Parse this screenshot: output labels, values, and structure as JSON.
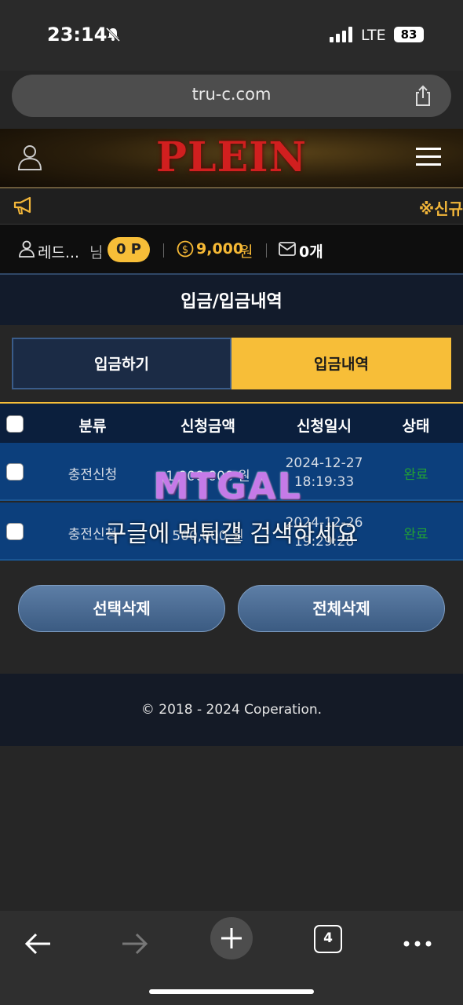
{
  "status_bar": {
    "time": "23:14",
    "network": "LTE",
    "battery": "83"
  },
  "browser": {
    "url": "tru-c.com",
    "tabs_count": "4"
  },
  "header": {
    "logo": "PLEIN"
  },
  "notice": {
    "text": "※신규"
  },
  "user": {
    "name": "레드...",
    "suffix": "님",
    "points": "0 P",
    "money": "9,000",
    "money_unit": "원",
    "messages": "0개"
  },
  "page": {
    "title": "입금/입금내역"
  },
  "tabs": [
    {
      "label": "입금하기"
    },
    {
      "label": "입금내역",
      "active": true
    }
  ],
  "table": {
    "columns": [
      "분류",
      "신청금액",
      "신청일시",
      "상태"
    ],
    "rows": [
      {
        "type": "충전신청",
        "amount": "1,000,000 원",
        "date": "2024-12-27",
        "time": "18:19:33",
        "status": "완료"
      },
      {
        "type": "충전신청",
        "amount": "500,000 원",
        "date": "2024-12-26",
        "time": "19:29:28",
        "status": "완료"
      }
    ]
  },
  "watermark": {
    "logo": "MTGAL",
    "text": "구글에 먹튀갤 검색하세요"
  },
  "actions": {
    "delete_selected": "선택삭제",
    "delete_all": "전체삭제"
  },
  "footer": {
    "copyright": "© 2018 - 2024 Coperation."
  },
  "colors": {
    "accent": "#f7be38",
    "status_done": "#21a035",
    "row_bg": "#0c3f7c"
  }
}
